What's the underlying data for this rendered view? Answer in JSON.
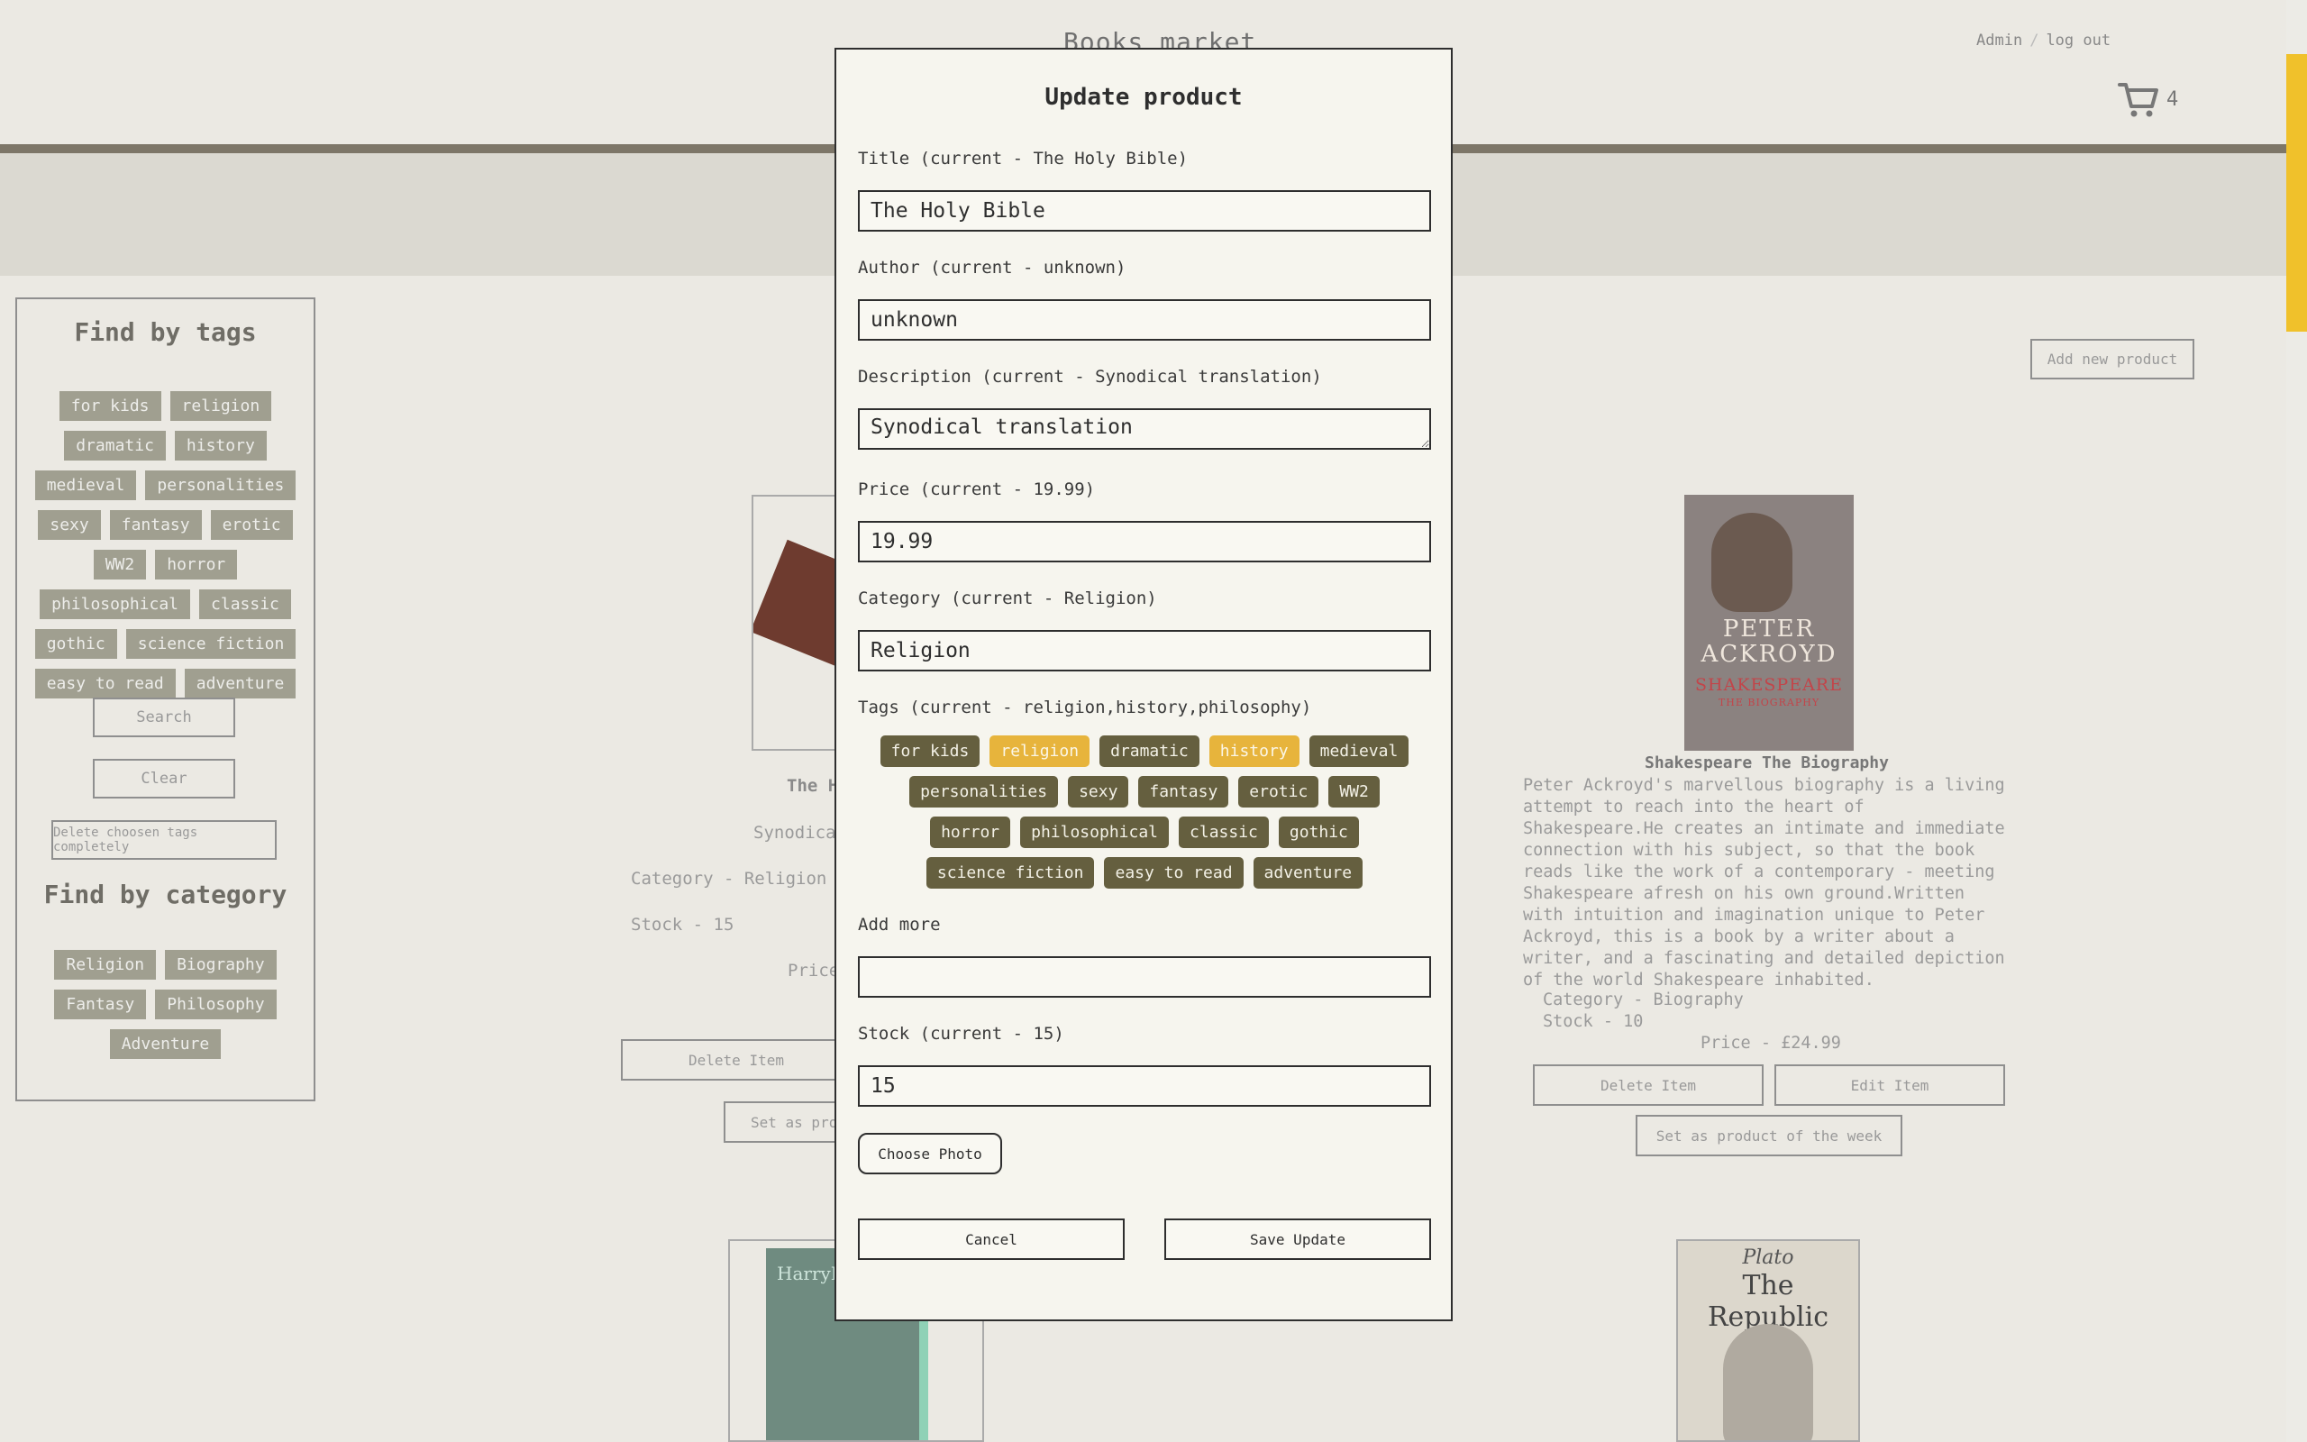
{
  "header": {
    "site_title": "Books market",
    "admin_link": "Admin",
    "logout_link": "log out",
    "cart_count": "4"
  },
  "sidebar": {
    "tags_heading": "Find by tags",
    "tags": [
      "for kids",
      "religion",
      "dramatic",
      "history",
      "medieval",
      "personalities",
      "sexy",
      "fantasy",
      "erotic",
      "WW2",
      "horror",
      "philosophical",
      "classic",
      "gothic",
      "science fiction",
      "easy to read",
      "adventure"
    ],
    "search_label": "Search",
    "clear_label": "Clear",
    "delete_tags_label": "Delete choosen tags completely",
    "category_heading": "Find by category",
    "categories": [
      "Religion",
      "Biography",
      "Fantasy",
      "Philosophy",
      "Adventure"
    ]
  },
  "main": {
    "add_new_label": "Add new product",
    "left_card": {
      "title_partial": "The H",
      "desc_partial": "Synodica",
      "category": "Category - Religion",
      "stock": "Stock - 15",
      "price_partial": "Price",
      "delete_label": "Delete Item",
      "set_week_partial": "Set as prod"
    },
    "right_card": {
      "title": "Shakespeare The Biography",
      "description": "Peter Ackroyd's marvellous biography is a living attempt to reach into the heart of Shakespeare.He creates an intimate and immediate connection with his subject, so that the book reads like the work of a contemporary - meeting Shakespeare afresh on his own ground.Written with intuition and imagination unique to Peter Ackroyd, this is a book by a writer about a writer, and a fascinating and detailed depiction of the world Shakespeare inhabited.",
      "category": "Category - Biography",
      "stock": "Stock - 10",
      "price": "Price - £24.99",
      "delete_label": "Delete Item",
      "edit_label": "Edit Item",
      "set_week_label": "Set as product of the week",
      "cover_author_1": "PETER",
      "cover_author_2": "ACKROYD",
      "cover_title": "SHAKESPEARE",
      "cover_sub": "THE BIOGRAPHY"
    },
    "bottom_right_cover": {
      "author": "Plato",
      "title": "The Republic"
    },
    "bottom_left_cover": {
      "text": "HarryP"
    }
  },
  "modal": {
    "title": "Update product",
    "title_label": "Title (current - The Holy Bible)",
    "title_value": "The Holy Bible",
    "author_label": "Author (current - unknown)",
    "author_value": "unknown",
    "description_label": "Description (current - Synodical translation)",
    "description_value": "Synodical translation",
    "price_label": "Price (current - 19.99)",
    "price_value": "19.99",
    "category_label": "Category (current - Religion)",
    "category_value": "Religion",
    "tags_label": "Tags (current - religion,history,philosophy)",
    "tags": [
      {
        "label": "for kids",
        "selected": false
      },
      {
        "label": "religion",
        "selected": true
      },
      {
        "label": "dramatic",
        "selected": false
      },
      {
        "label": "history",
        "selected": true
      },
      {
        "label": "medieval",
        "selected": false
      },
      {
        "label": "personalities",
        "selected": false
      },
      {
        "label": "sexy",
        "selected": false
      },
      {
        "label": "fantasy",
        "selected": false
      },
      {
        "label": "erotic",
        "selected": false
      },
      {
        "label": "WW2",
        "selected": false
      },
      {
        "label": "horror",
        "selected": false
      },
      {
        "label": "philosophical",
        "selected": false
      },
      {
        "label": "classic",
        "selected": false
      },
      {
        "label": "gothic",
        "selected": false
      },
      {
        "label": "science fiction",
        "selected": false
      },
      {
        "label": "easy to read",
        "selected": false
      },
      {
        "label": "adventure",
        "selected": false
      }
    ],
    "add_more_label": "Add more",
    "add_more_value": "",
    "stock_label": "Stock (current - 15)",
    "stock_value": "15",
    "choose_photo_label": "Choose Photo",
    "cancel_label": "Cancel",
    "save_label": "Save Update"
  },
  "colors": {
    "accent": "#e7b43c",
    "tag_dark": "#655f3f",
    "scroll_thumb": "#f0c12b"
  }
}
